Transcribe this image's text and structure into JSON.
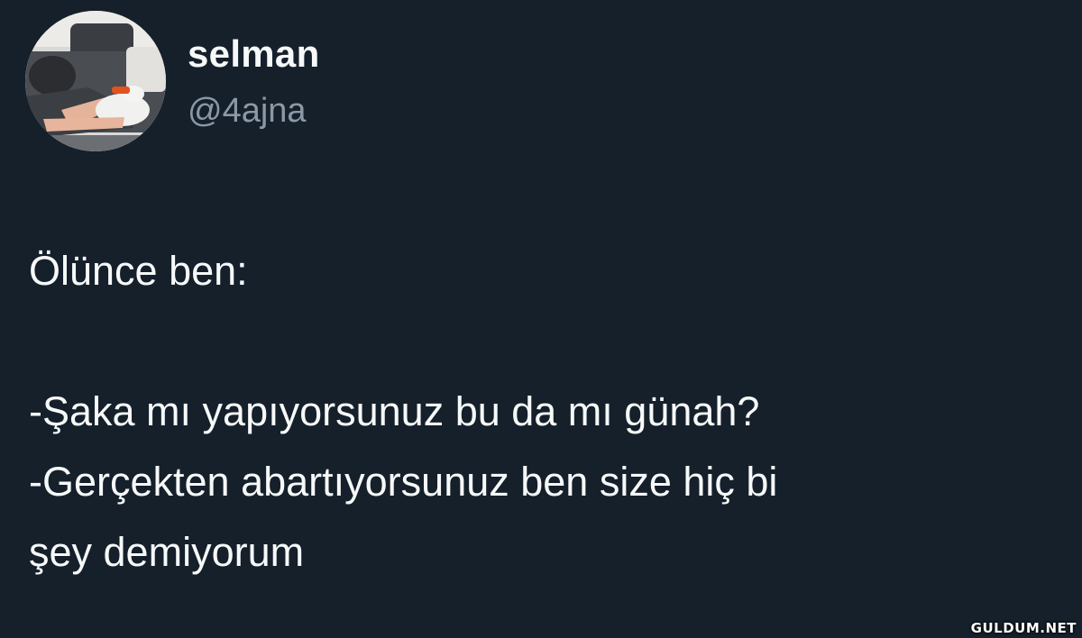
{
  "tweet": {
    "display_name": "selman",
    "handle": "@4ajna",
    "avatar_icon": "profile-photo",
    "lines": [
      "Ölünce ben:",
      "",
      "-Şaka mı yapıyorsunuz bu da mı günah?",
      "-Gerçekten abartıyorsunuz ben size hiç bi",
      "şey demiyorum"
    ]
  },
  "watermark": "GULDUM.NET",
  "colors": {
    "background": "#15202b",
    "text": "#f7f9f9",
    "handle": "#8b98a5"
  }
}
